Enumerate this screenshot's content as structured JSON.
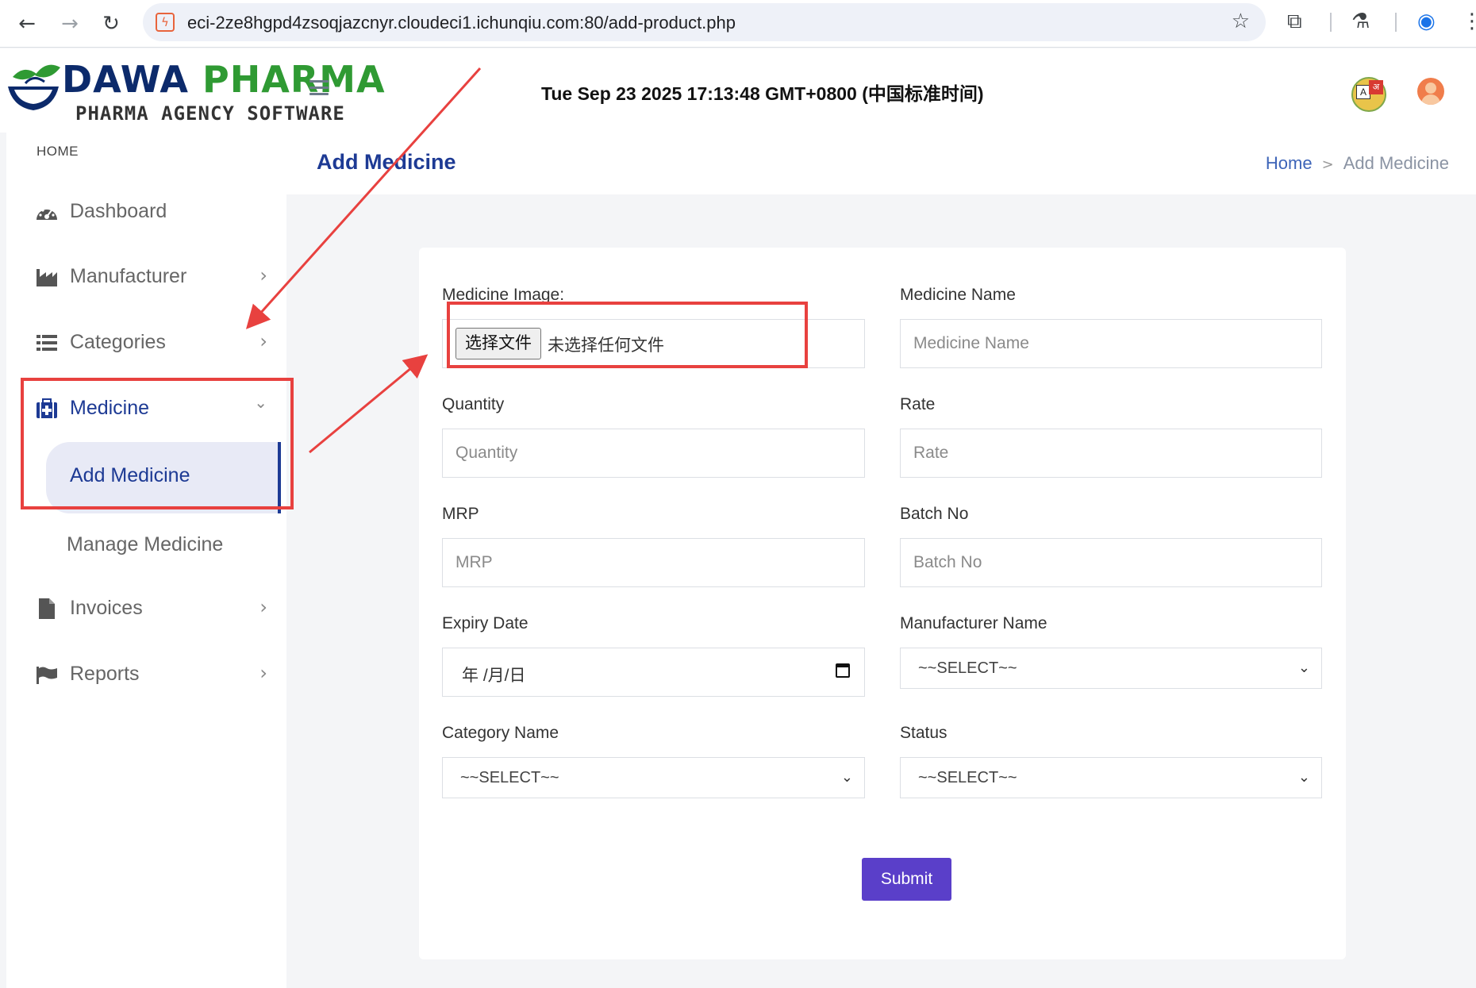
{
  "browser": {
    "url": "eci-2ze8hgpd4zsoqjazcnyr.cloudeci1.ichunqiu.com:80/add-product.php"
  },
  "header": {
    "logo_part1": "DAWA",
    "logo_part2": "PHARMA",
    "logo_subtitle": "PHARMA AGENCY SOFTWARE",
    "datetime": "Tue Sep 23 2025 17:13:48 GMT+0800 (中国标准时间)"
  },
  "sidebar": {
    "heading": "HOME",
    "items": [
      {
        "label": "Dashboard"
      },
      {
        "label": "Manufacturer"
      },
      {
        "label": "Categories"
      },
      {
        "label": "Medicine"
      },
      {
        "label": "Invoices"
      },
      {
        "label": "Reports"
      }
    ],
    "sub_items": [
      {
        "label": "Add Medicine"
      },
      {
        "label": "Manage Medicine"
      }
    ]
  },
  "page": {
    "title": "Add Medicine",
    "breadcrumb_home": "Home",
    "breadcrumb_current": "Add Medicine"
  },
  "form": {
    "image_label": "Medicine Image:",
    "file_button": "选择文件",
    "file_status": "未选择任何文件",
    "name_label": "Medicine Name",
    "name_placeholder": "Medicine Name",
    "quantity_label": "Quantity",
    "quantity_placeholder": "Quantity",
    "rate_label": "Rate",
    "rate_placeholder": "Rate",
    "mrp_label": "MRP",
    "mrp_placeholder": "MRP",
    "batch_label": "Batch No",
    "batch_placeholder": "Batch No",
    "expiry_label": "Expiry Date",
    "expiry_value": "年 /月/日",
    "manufacturer_label": "Manufacturer Name",
    "manufacturer_value": "~~SELECT~~",
    "category_label": "Category Name",
    "category_value": "~~SELECT~~",
    "status_label": "Status",
    "status_value": "~~SELECT~~",
    "submit_label": "Submit"
  },
  "colors": {
    "brand_navy": "#0c2a6b",
    "brand_green": "#2f9a33",
    "active_blue": "#1d3a94",
    "submit_purple": "#5a3fc9",
    "annotation_red": "#e8413f"
  }
}
